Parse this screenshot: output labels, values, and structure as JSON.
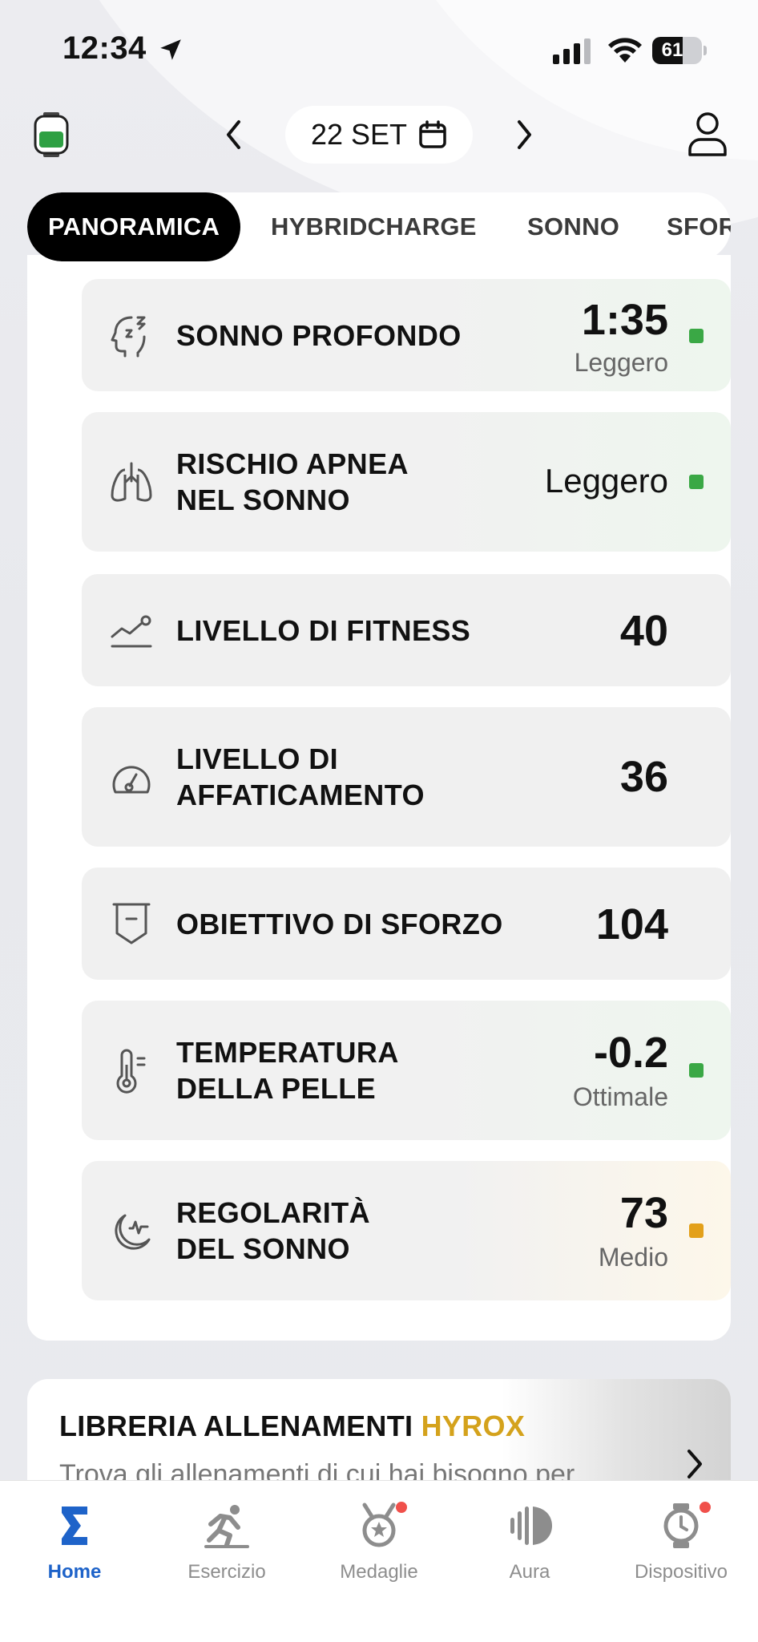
{
  "status_bar": {
    "time": "12:34",
    "battery": "61",
    "battery_level": 0.61
  },
  "header": {
    "date": "22 SET"
  },
  "tabs": [
    {
      "label": "PANORAMICA",
      "active": true
    },
    {
      "label": "HYBRIDCHARGE",
      "active": false
    },
    {
      "label": "SONNO",
      "active": false
    },
    {
      "label": "SFORZO",
      "active": false
    }
  ],
  "metrics": [
    {
      "icon": "head-sleep-icon",
      "label_1": "SONNO PROFONDO",
      "label_2": "",
      "value": "1:35",
      "status": "Leggero",
      "status_color": "#3aa845"
    },
    {
      "icon": "lungs-icon",
      "label_1": "RISCHIO APNEA",
      "label_2": "NEL SONNO",
      "value": "Leggero",
      "status": "",
      "status_color": "#3aa845"
    },
    {
      "icon": "trend-chart-icon",
      "label_1": "LIVELLO DI FITNESS",
      "label_2": "",
      "value": "40",
      "status": "",
      "status_color": ""
    },
    {
      "icon": "gauge-icon",
      "label_1": "LIVELLO DI",
      "label_2": "AFFATICAMENTO",
      "value": "36",
      "status": "",
      "status_color": ""
    },
    {
      "icon": "shield-goal-icon",
      "label_1": "OBIETTIVO DI SFORZO",
      "label_2": "",
      "value": "104",
      "status": "",
      "status_color": ""
    },
    {
      "icon": "thermometer-icon",
      "label_1": "TEMPERATURA",
      "label_2": "DELLA PELLE",
      "value": "-0.2",
      "status": "Ottimale",
      "status_color": "#3aa845"
    },
    {
      "icon": "moon-pulse-icon",
      "label_1": "REGOLARITÀ",
      "label_2": "DEL SONNO",
      "value": "73",
      "status": "Medio",
      "status_color": "#e3a01a"
    }
  ],
  "library": {
    "title": "LIBRERIA ALLENAMENTI",
    "title_accent": "HYROX",
    "subtitle": "Trova gli allenamenti di cui hai bisogno per"
  },
  "nav": [
    {
      "label": "Home",
      "icon": "sigma-icon"
    },
    {
      "label": "Esercizio",
      "icon": "runner-icon"
    },
    {
      "label": "Medaglie",
      "icon": "medal-icon"
    },
    {
      "label": "Aura",
      "icon": "aura-icon"
    },
    {
      "label": "Dispositivo",
      "icon": "watch-icon"
    }
  ],
  "colors": {
    "accent": "#1e63c9",
    "hyrox": "#d4a21c",
    "good": "#3aa845",
    "medium": "#e3a01a",
    "badge": "#f0504b"
  }
}
